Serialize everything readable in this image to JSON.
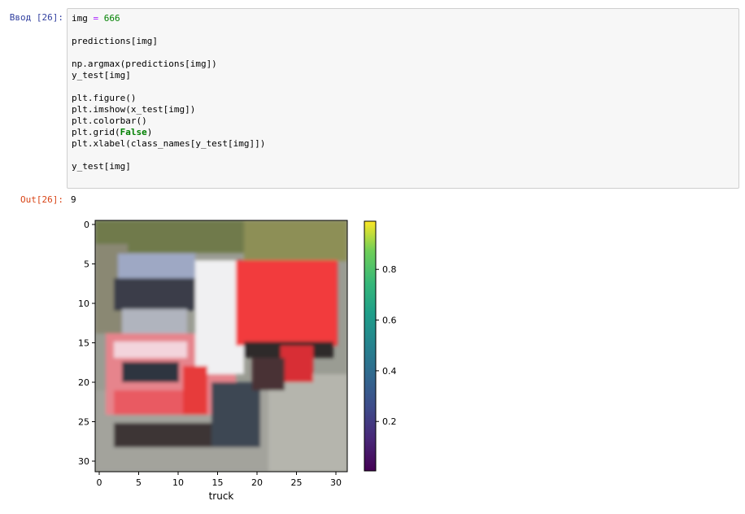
{
  "cell": {
    "input_prompt": "Ввод [26]:",
    "output_prompt": "Out[26]:",
    "output_value": "9",
    "code_lines": [
      [
        {
          "t": "img "
        },
        {
          "t": "=",
          "c": "op"
        },
        {
          "t": " "
        },
        {
          "t": "666",
          "c": "num"
        }
      ],
      [],
      [
        {
          "t": "predictions[img]"
        }
      ],
      [],
      [
        {
          "t": "np.argmax(predictions[img])"
        }
      ],
      [
        {
          "t": "y_test[img]"
        }
      ],
      [],
      [
        {
          "t": "plt.figure()"
        }
      ],
      [
        {
          "t": "plt.imshow(x_test[img])"
        }
      ],
      [
        {
          "t": "plt.colorbar()"
        }
      ],
      [
        {
          "t": "plt.grid("
        },
        {
          "t": "False",
          "c": "kw"
        },
        {
          "t": ")"
        }
      ],
      [
        {
          "t": "plt.xlabel(class_names[y_test[img]])"
        }
      ],
      [],
      [
        {
          "t": "y_test[img]"
        }
      ]
    ]
  },
  "figure": {
    "xlabel": "truck",
    "x_ticks": [
      "0",
      "5",
      "10",
      "15",
      "20",
      "25",
      "30"
    ],
    "y_ticks": [
      "0",
      "5",
      "10",
      "15",
      "20",
      "25",
      "30"
    ],
    "colorbar": {
      "colormap": "viridis",
      "ticks": [
        "0.2",
        "0.4",
        "0.6",
        "0.8"
      ]
    }
  },
  "colors": {
    "input_prompt": "#303f9f",
    "output_prompt": "#d84315",
    "truck_red": "#e83a3a"
  }
}
